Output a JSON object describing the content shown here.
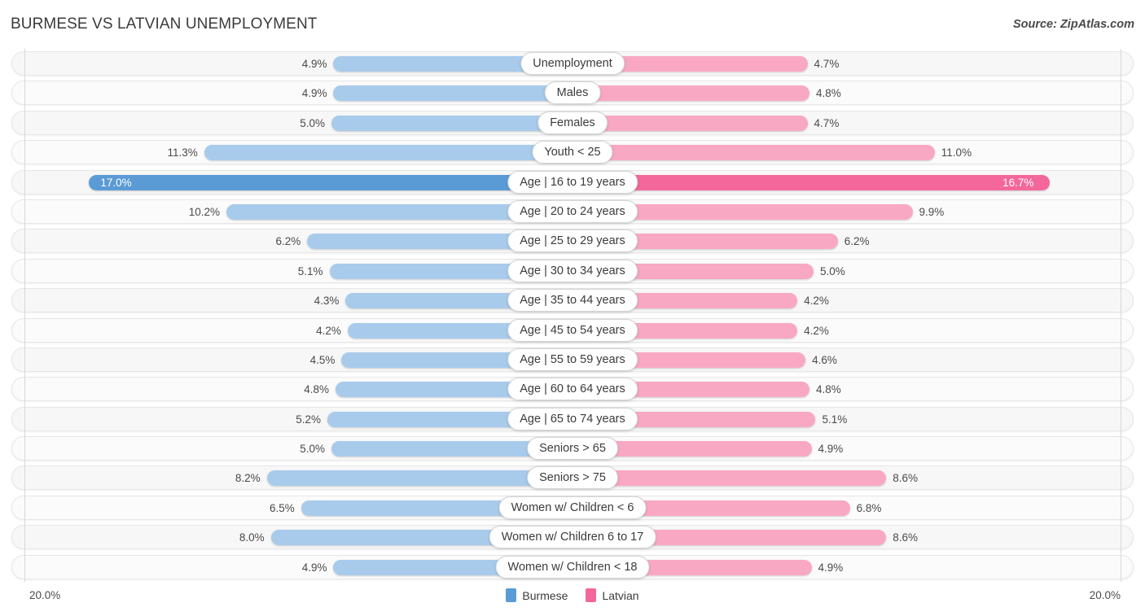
{
  "header": {
    "title": "BURMESE VS LATVIAN UNEMPLOYMENT",
    "source": "Source: ZipAtlas.com"
  },
  "footer": {
    "axis_min_left": "20.0%",
    "axis_min_right": "20.0%"
  },
  "legend": [
    {
      "label": "Burmese",
      "color": "#5b9bd5"
    },
    {
      "label": "Latvian",
      "color": "#f4679a"
    }
  ],
  "colors": {
    "burmese_light": "#a8cbec",
    "burmese_strong": "#5b9bd5",
    "latvian_light": "#f9a8c4",
    "latvian_strong": "#f4679a",
    "track": "#f7f7f7",
    "axis": "#d8d8d8",
    "text": "#4a4a4a"
  },
  "chart_data": {
    "type": "bar",
    "title": "BURMESE VS LATVIAN UNEMPLOYMENT",
    "subtitle": "",
    "orientation": "horizontal-diverging",
    "xlabel": "",
    "ylabel": "",
    "xlim": [
      -20.0,
      20.0
    ],
    "axis_max_label": "20.0%",
    "grid": false,
    "legend_position": "bottom-center",
    "unit": "%",
    "categories": [
      "Unemployment",
      "Males",
      "Females",
      "Youth < 25",
      "Age | 16 to 19 years",
      "Age | 20 to 24 years",
      "Age | 25 to 29 years",
      "Age | 30 to 34 years",
      "Age | 35 to 44 years",
      "Age | 45 to 54 years",
      "Age | 55 to 59 years",
      "Age | 60 to 64 years",
      "Age | 65 to 74 years",
      "Seniors > 65",
      "Seniors > 75",
      "Women w/ Children < 6",
      "Women w/ Children 6 to 17",
      "Women w/ Children < 18"
    ],
    "series": [
      {
        "name": "Burmese",
        "side": "left",
        "color": "#a8cbec",
        "values": [
          4.9,
          4.9,
          5.0,
          11.3,
          17.0,
          10.2,
          6.2,
          5.1,
          4.3,
          4.2,
          4.5,
          4.8,
          5.2,
          5.0,
          8.2,
          6.5,
          8.0,
          4.9
        ],
        "labels": [
          "4.9%",
          "4.9%",
          "5.0%",
          "11.3%",
          "17.0%",
          "10.2%",
          "6.2%",
          "5.1%",
          "4.3%",
          "4.2%",
          "4.5%",
          "4.8%",
          "5.2%",
          "5.0%",
          "8.2%",
          "6.5%",
          "8.0%",
          "4.9%"
        ]
      },
      {
        "name": "Latvian",
        "side": "right",
        "color": "#f9a8c4",
        "values": [
          4.7,
          4.8,
          4.7,
          11.0,
          16.7,
          9.9,
          6.2,
          5.0,
          4.2,
          4.2,
          4.6,
          4.8,
          5.1,
          4.9,
          8.6,
          6.8,
          8.6,
          4.9
        ],
        "labels": [
          "4.7%",
          "4.8%",
          "4.7%",
          "11.0%",
          "16.7%",
          "9.9%",
          "6.2%",
          "5.0%",
          "4.2%",
          "4.2%",
          "4.6%",
          "4.8%",
          "5.1%",
          "4.9%",
          "8.6%",
          "6.8%",
          "8.6%",
          "4.9%"
        ]
      }
    ],
    "highlighted_row_index": 4,
    "highlighted_row_label": "Age | 16 to 19 years"
  }
}
